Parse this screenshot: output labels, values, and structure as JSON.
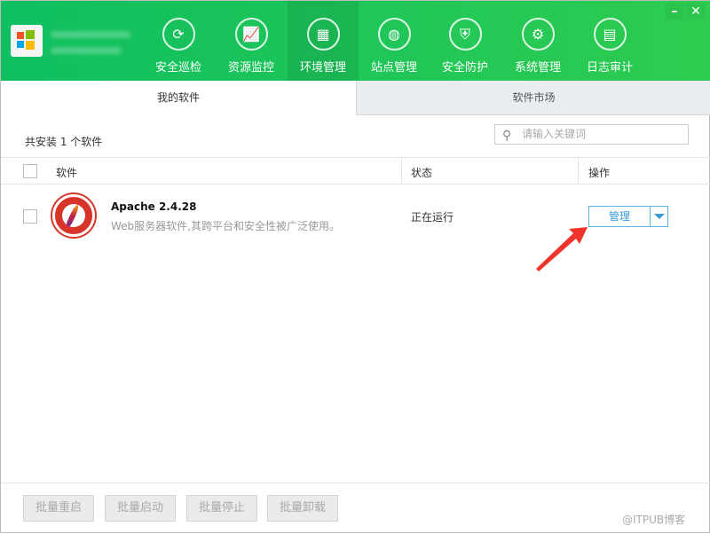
{
  "header": {
    "nav": [
      {
        "label": "安全巡检",
        "icon": "refresh-scan-icon",
        "glyph": "⟳"
      },
      {
        "label": "资源监控",
        "icon": "monitor-chart-icon",
        "glyph": "📈"
      },
      {
        "label": "环境管理",
        "icon": "building-icon",
        "glyph": "▦",
        "active": true
      },
      {
        "label": "站点管理",
        "icon": "globe-icon",
        "glyph": "◍"
      },
      {
        "label": "安全防护",
        "icon": "shield-icon",
        "glyph": "⛨"
      },
      {
        "label": "系统管理",
        "icon": "settings-monitor-icon",
        "glyph": "⚙"
      },
      {
        "label": "日志审计",
        "icon": "document-icon",
        "glyph": "▤"
      }
    ],
    "minimize": "–",
    "close": "✕"
  },
  "tabs": [
    "我的软件",
    "软件市场"
  ],
  "summary": "共安装 1 个软件",
  "search": {
    "placeholder": "请输入关键词",
    "icon": "⚲"
  },
  "table": {
    "columns": [
      "软件",
      "状态",
      "操作"
    ],
    "rows": [
      {
        "name": "Apache 2.4.28",
        "description": "Web服务器软件,其跨平台和安全性被广泛使用。",
        "status": "正在运行",
        "action": "管理"
      }
    ]
  },
  "batch_buttons": [
    "批量重启",
    "批量启动",
    "批量停止",
    "批量卸载"
  ],
  "watermark": "@ITPUB博客",
  "colors": {
    "header": "#15c05c",
    "accent": "#3a9bd5",
    "arrow": "#f0332b"
  }
}
